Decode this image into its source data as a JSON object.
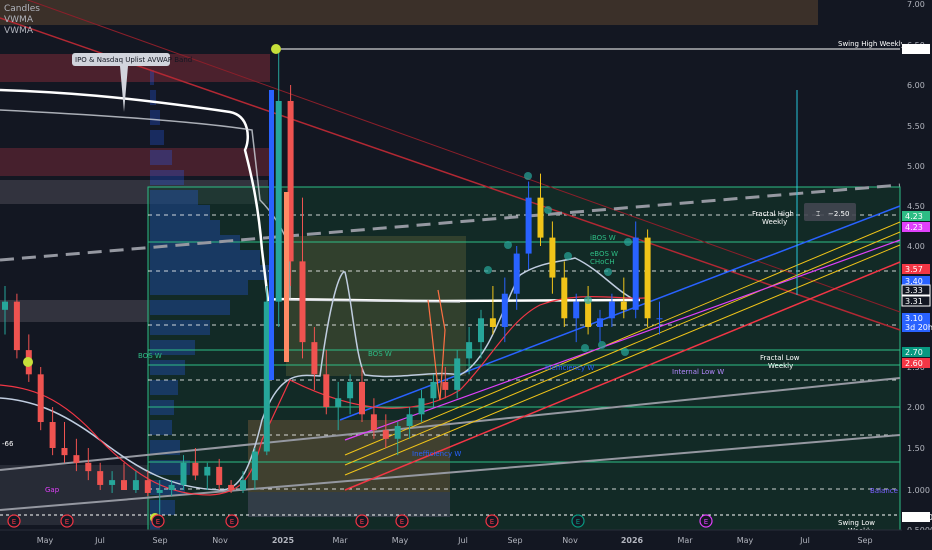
{
  "indicators": [
    "Candles",
    "VWMA",
    "VWMA"
  ],
  "annotations": {
    "ipo_band": "IPO & Nasdaq Uplist AVWAP Band",
    "swing_high": "Swing High Weekly",
    "fractal_high": "Fractal High\nWeekly",
    "fractal_low": "Fractal Low\nWeekly",
    "internal_low": "Internal Low W",
    "balance": "Balance",
    "swing_low": "Swing Low\nWeekly",
    "bos_w_left": "BOS W",
    "bos_w_mid": "BOS W",
    "ibos_w": "iBOS W",
    "ebos_w": "eBOS W",
    "choch": "CHoCH",
    "inefficiency_1": "Inefficiency W",
    "inefficiency_2": "Inefficiency W",
    "measure": "−2.50",
    "gap": "Gap",
    "left_val": "-66"
  },
  "chart_data": {
    "type": "candlestick",
    "title": "",
    "y_axis": {
      "side": "right",
      "scale": "log",
      "ticks": [
        "7.00",
        "6.50",
        "6.00",
        "5.50",
        "5.00",
        "4.50",
        "4.00",
        "3.50",
        "3.00",
        "2.50",
        "2.00",
        "1.50",
        "1.000",
        "0.5000"
      ],
      "range": [
        0.5,
        7.0
      ]
    },
    "x_axis": {
      "ticks": [
        "May",
        "Jul",
        "Sep",
        "Nov",
        "2025",
        "Mar",
        "May",
        "Jul",
        "Sep",
        "Nov",
        "2026",
        "Mar",
        "May",
        "Jul",
        "Sep"
      ]
    },
    "price_tags": [
      {
        "value": "6.43",
        "color": "#ffffff",
        "text_color": "#131722"
      },
      {
        "value": "4.23",
        "color": "#2ebd85"
      },
      {
        "value": "4.23",
        "color": "#e040fb"
      },
      {
        "value": "3.57",
        "color": "#f23645"
      },
      {
        "value": "3.40",
        "color": "#2962ff"
      },
      {
        "value": "3.33",
        "color": "#131722",
        "text_color": "#ffffff",
        "border": "#ffffff"
      },
      {
        "value": "3.31",
        "color": "#131722",
        "text_color": "#ffffff",
        "border": "#ffffff"
      },
      {
        "value": "3.10",
        "color": "#2962ff"
      },
      {
        "value": "3d 20h",
        "color": "#2962ff"
      },
      {
        "value": "2.70",
        "color": "#089981"
      },
      {
        "value": "2.60",
        "color": "#f23645"
      },
      {
        "value": "0.6400",
        "color": "#ffffff",
        "text_color": "#131722"
      }
    ],
    "event_markers": [
      "E",
      "E",
      "E",
      "E",
      "E",
      "E",
      "E",
      "E",
      "E"
    ],
    "candles": [
      [
        3.2,
        3.5,
        2.9,
        3.3
      ],
      [
        3.3,
        3.4,
        2.6,
        2.7
      ],
      [
        2.7,
        2.9,
        2.3,
        2.4
      ],
      [
        2.4,
        2.5,
        1.7,
        1.8
      ],
      [
        1.8,
        2.0,
        1.4,
        1.5
      ],
      [
        1.5,
        1.8,
        1.3,
        1.4
      ],
      [
        1.4,
        1.6,
        1.2,
        1.3
      ],
      [
        1.3,
        1.5,
        1.1,
        1.2
      ],
      [
        1.2,
        1.3,
        1.0,
        1.05
      ],
      [
        1.05,
        1.2,
        0.95,
        1.1
      ],
      [
        1.1,
        1.3,
        1.0,
        1.0
      ],
      [
        1.0,
        1.2,
        0.95,
        1.1
      ],
      [
        1.1,
        1.2,
        0.9,
        0.95
      ],
      [
        0.95,
        1.1,
        0.64,
        1.0
      ],
      [
        1.0,
        1.1,
        0.9,
        1.05
      ],
      [
        1.05,
        1.4,
        1.0,
        1.3
      ],
      [
        1.3,
        1.5,
        1.1,
        1.15
      ],
      [
        1.15,
        1.3,
        1.0,
        1.25
      ],
      [
        1.25,
        1.35,
        1.0,
        1.05
      ],
      [
        1.05,
        1.1,
        0.95,
        1.0
      ],
      [
        1.0,
        1.2,
        0.95,
        1.1
      ],
      [
        1.1,
        1.5,
        1.0,
        1.45
      ],
      [
        1.45,
        3.5,
        1.4,
        3.3
      ],
      [
        3.3,
        6.43,
        3.0,
        5.8
      ],
      [
        5.8,
        6.0,
        3.5,
        3.8
      ],
      [
        3.8,
        4.6,
        2.6,
        2.8
      ],
      [
        2.8,
        3.0,
        2.2,
        2.4
      ],
      [
        2.4,
        2.7,
        1.9,
        2.0
      ],
      [
        2.0,
        2.3,
        1.7,
        2.1
      ],
      [
        2.1,
        2.4,
        1.9,
        2.3
      ],
      [
        2.3,
        2.5,
        1.8,
        1.9
      ],
      [
        1.9,
        2.1,
        1.6,
        1.7
      ],
      [
        1.7,
        1.9,
        1.5,
        1.6
      ],
      [
        1.6,
        1.8,
        1.4,
        1.75
      ],
      [
        1.75,
        2.0,
        1.6,
        1.9
      ],
      [
        1.9,
        2.2,
        1.8,
        2.1
      ],
      [
        2.1,
        2.4,
        2.0,
        2.3
      ],
      [
        2.3,
        2.5,
        2.1,
        2.2
      ],
      [
        2.2,
        2.7,
        2.1,
        2.6
      ],
      [
        2.6,
        3.0,
        2.4,
        2.8
      ],
      [
        2.8,
        3.2,
        2.6,
        3.1
      ],
      [
        3.1,
        3.5,
        2.9,
        3.0
      ],
      [
        3.0,
        3.6,
        2.8,
        3.4
      ],
      [
        3.4,
        4.0,
        3.2,
        3.9
      ],
      [
        3.9,
        4.8,
        3.7,
        4.6
      ],
      [
        4.6,
        4.9,
        4.0,
        4.1
      ],
      [
        4.1,
        4.3,
        3.4,
        3.6
      ],
      [
        3.6,
        3.8,
        3.0,
        3.1
      ],
      [
        3.1,
        3.4,
        2.8,
        3.3
      ],
      [
        3.3,
        3.5,
        2.9,
        3.0
      ],
      [
        3.0,
        3.2,
        2.8,
        3.1
      ],
      [
        3.1,
        3.4,
        3.0,
        3.3
      ],
      [
        3.3,
        3.6,
        3.1,
        3.2
      ],
      [
        3.2,
        4.3,
        3.1,
        4.1
      ],
      [
        4.1,
        4.2,
        3.0,
        3.1
      ],
      [
        3.1,
        3.3,
        2.9,
        3.1
      ]
    ]
  }
}
